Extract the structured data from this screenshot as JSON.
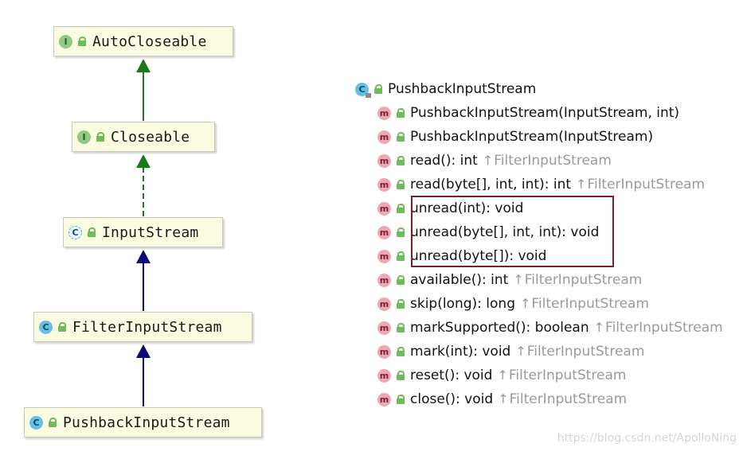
{
  "hierarchy": {
    "nodes": [
      {
        "id": "autocloseable",
        "label": "AutoCloseable",
        "kind": "interface",
        "badge": "I"
      },
      {
        "id": "closeable",
        "label": "Closeable",
        "kind": "interface",
        "badge": "I"
      },
      {
        "id": "inputstream",
        "label": "InputStream",
        "kind": "abstract-class",
        "badge": "C"
      },
      {
        "id": "filterinputstream",
        "label": "FilterInputStream",
        "kind": "class",
        "badge": "C"
      },
      {
        "id": "pushbackinputstream",
        "label": "PushbackInputStream",
        "kind": "class",
        "badge": "C"
      }
    ],
    "edges": [
      {
        "from": "closeable",
        "to": "autocloseable",
        "type": "extends",
        "color": "#1a7a1a"
      },
      {
        "from": "inputstream",
        "to": "closeable",
        "type": "implements",
        "color": "#1a7a1a"
      },
      {
        "from": "filterinputstream",
        "to": "inputstream",
        "type": "extends",
        "color": "#0b0b7a"
      },
      {
        "from": "pushbackinputstream",
        "to": "filterinputstream",
        "type": "extends",
        "color": "#0b0b7a"
      }
    ]
  },
  "structure": {
    "class_name": "PushbackInputStream",
    "class_badge": "C",
    "method_badge": "m",
    "inherit_arrow": "↑",
    "members": [
      {
        "sig": "PushbackInputStream(InputStream, int)",
        "inherited": ""
      },
      {
        "sig": "PushbackInputStream(InputStream)",
        "inherited": ""
      },
      {
        "sig": "read(): int",
        "inherited": "FilterInputStream"
      },
      {
        "sig": "read(byte[], int, int): int",
        "inherited": "FilterInputStream"
      },
      {
        "sig": "unread(int): void",
        "inherited": ""
      },
      {
        "sig": "unread(byte[], int, int): void",
        "inherited": ""
      },
      {
        "sig": "unread(byte[]): void",
        "inherited": ""
      },
      {
        "sig": "available(): int",
        "inherited": "FilterInputStream"
      },
      {
        "sig": "skip(long): long",
        "inherited": "FilterInputStream"
      },
      {
        "sig": "markSupported(): boolean",
        "inherited": "FilterInputStream"
      },
      {
        "sig": "mark(int): void",
        "inherited": "FilterInputStream"
      },
      {
        "sig": "reset(): void",
        "inherited": "FilterInputStream"
      },
      {
        "sig": "close(): void",
        "inherited": "FilterInputStream"
      }
    ]
  },
  "watermark": "https://blog.csdn.net/ApolloNing",
  "colors": {
    "highlight_border": "#7c1d2e",
    "interface_badge": "#8fc983",
    "class_badge": "#68bfe6",
    "method_badge": "#f0a7b3",
    "lock_green": "#6dbb5a",
    "inherited_text": "#9a9a9a"
  }
}
